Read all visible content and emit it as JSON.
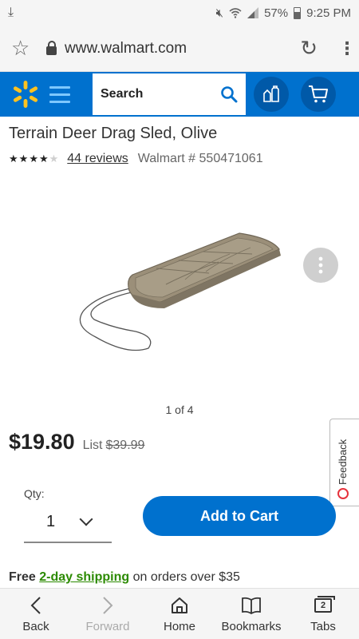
{
  "status_bar": {
    "battery": "57%",
    "time": "9:25 PM"
  },
  "browser": {
    "url": "www.walmart.com"
  },
  "header": {
    "search_label": "Search"
  },
  "product": {
    "title": "Terrain Deer Drag Sled, Olive",
    "rating_stars": 4,
    "rating_max": 5,
    "reviews_link": "44 reviews",
    "item_number": "Walmart # 550471061",
    "image_counter": "1 of 4",
    "price": "$19.80",
    "list_label": "List",
    "list_price": "$39.99"
  },
  "purchase": {
    "qty_label": "Qty:",
    "qty_value": "1",
    "add_to_cart": "Add to Cart"
  },
  "shipping": {
    "free": "Free",
    "two_day": "2-day shipping",
    "rest": "on orders over $35"
  },
  "feedback": {
    "label": "Feedback"
  },
  "bottom_nav": {
    "back": "Back",
    "forward": "Forward",
    "home": "Home",
    "bookmarks": "Bookmarks",
    "tabs": "Tabs",
    "tab_count": "2"
  },
  "colors": {
    "brand_blue": "#0071ce",
    "spark_yellow": "#ffc220",
    "shipping_green": "#2b8a00",
    "sled_olive": "#9b8f79"
  }
}
